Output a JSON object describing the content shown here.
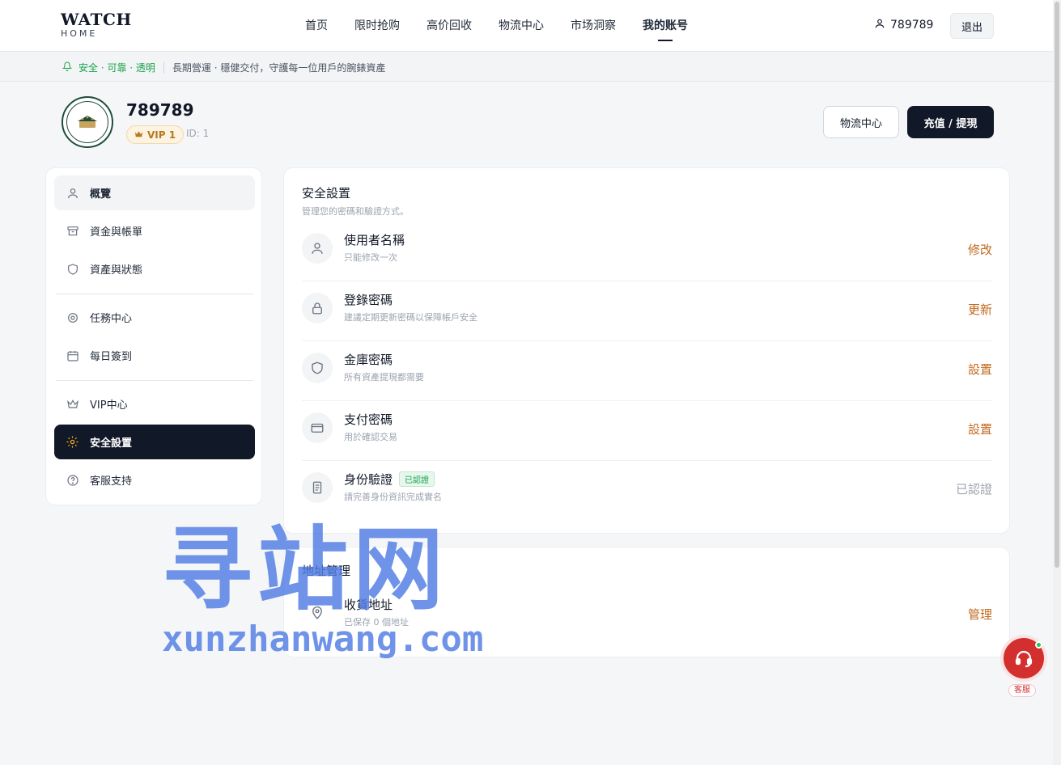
{
  "brand": {
    "title": "WATCH",
    "subtitle": "HOME"
  },
  "nav": {
    "items": [
      {
        "label": "首页"
      },
      {
        "label": "限时抢购"
      },
      {
        "label": "高价回收"
      },
      {
        "label": "物流中心"
      },
      {
        "label": "市场洞察"
      },
      {
        "label": "我的账号"
      }
    ],
    "active_index": 5
  },
  "header": {
    "username": "789789",
    "logout_label": "退出"
  },
  "ribbon": {
    "tag": "安全 · 可靠 · 透明",
    "text": "長期營運 · 穩健交付，守護每一位用戶的腕錶資產",
    "accent_color": "#16a34a"
  },
  "profile": {
    "name": "789789",
    "vip_label": "VIP 1",
    "id_text": "ID: 1",
    "logistics_button": "物流中心",
    "recharge_button": "充值 / 提現"
  },
  "sidebar": {
    "items": [
      {
        "label": "概覽",
        "icon": "user-icon"
      },
      {
        "label": "資金與帳單",
        "icon": "archive-icon"
      },
      {
        "label": "資產與狀態",
        "icon": "shield-icon"
      },
      {
        "label": "任務中心",
        "icon": "target-icon"
      },
      {
        "label": "每日簽到",
        "icon": "calendar-icon"
      },
      {
        "label": "VIP中心",
        "icon": "crown-icon"
      },
      {
        "label": "安全設置",
        "icon": "gear-icon"
      },
      {
        "label": "客服支持",
        "icon": "help-icon"
      }
    ],
    "active_label": "安全設置"
  },
  "security": {
    "title": "安全設置",
    "subtitle": "管理您的密碼和驗證方式。",
    "rows": [
      {
        "title": "使用者名稱",
        "desc": "只能修改一次",
        "action": "修改",
        "icon": "user-icon"
      },
      {
        "title": "登錄密碼",
        "desc": "建議定期更新密碼以保障帳戶安全",
        "action": "更新",
        "icon": "lock-icon"
      },
      {
        "title": "金庫密碼",
        "desc": "所有資產提現都需要",
        "action": "設置",
        "icon": "shield-icon"
      },
      {
        "title": "支付密碼",
        "desc": "用於確認交易",
        "action": "設置",
        "icon": "card-icon"
      },
      {
        "title": "身份驗證",
        "tag": "已認證",
        "desc": "請完善身份資訊完成實名",
        "action": "已認證",
        "icon": "document-icon"
      }
    ]
  },
  "address": {
    "title": "地址管理",
    "row": {
      "title": "收貨地址",
      "desc": "已保存 0 個地址",
      "action": "管理",
      "icon": "pin-icon"
    }
  },
  "support": {
    "label": "客服"
  },
  "watermark": {
    "big": "寻站网",
    "small": "xunzhanwang.com"
  },
  "colors": {
    "action": "#c2691d",
    "dark": "#111827",
    "success": "#16a34a",
    "support": "#d32f2f",
    "vip": "#b7791f"
  }
}
